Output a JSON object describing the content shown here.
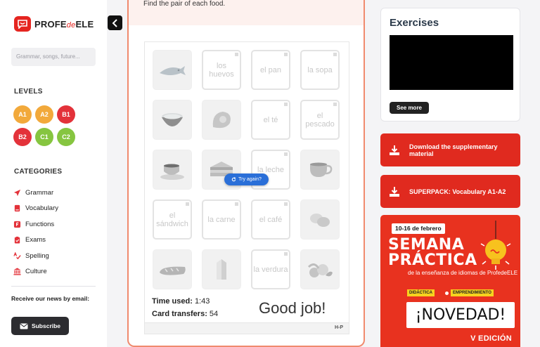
{
  "sidebar": {
    "logo": {
      "main": "PROFE",
      "de": "de",
      "end": "ELE"
    },
    "search_placeholder": "Grammar, songs, future...",
    "levels_title": "LEVELS",
    "levels": [
      {
        "label": "A1",
        "color": "#f2a93b"
      },
      {
        "label": "A2",
        "color": "#f2a93b"
      },
      {
        "label": "B1",
        "color": "#e3323a"
      },
      {
        "label": "B2",
        "color": "#e3323a"
      },
      {
        "label": "C1",
        "color": "#86c540"
      },
      {
        "label": "C2",
        "color": "#86c540"
      }
    ],
    "categories_title": "CATEGORIES",
    "categories": [
      {
        "label": "Grammar",
        "icon": "paper-plane-icon"
      },
      {
        "label": "Vocabulary",
        "icon": "book-icon"
      },
      {
        "label": "Functions",
        "icon": "f-square-icon"
      },
      {
        "label": "Exams",
        "icon": "clipboard-icon"
      },
      {
        "label": "Spelling",
        "icon": "spell-check-icon"
      },
      {
        "label": "Culture",
        "icon": "landmark-icon"
      }
    ],
    "news_text": "Receive our news by email:",
    "subscribe_label": "Subscribe"
  },
  "exercise": {
    "instruction": "Find the pair of each food.",
    "cards": [
      {
        "kind": "img",
        "icon": "fish-icon"
      },
      {
        "kind": "txt",
        "text": "los huevos"
      },
      {
        "kind": "txt",
        "text": "el pan"
      },
      {
        "kind": "txt",
        "text": "la sopa"
      },
      {
        "kind": "img",
        "icon": "soup-bowl-icon"
      },
      {
        "kind": "img",
        "icon": "ham-icon"
      },
      {
        "kind": "txt",
        "text": "el té"
      },
      {
        "kind": "txt",
        "text": "el pescado"
      },
      {
        "kind": "img",
        "icon": "coffee-cup-icon"
      },
      {
        "kind": "img",
        "icon": "sandwich-icon"
      },
      {
        "kind": "txt",
        "text": "la leche"
      },
      {
        "kind": "img",
        "icon": "tea-cup-icon"
      },
      {
        "kind": "txt",
        "text": "el sándwich"
      },
      {
        "kind": "txt",
        "text": "la carne"
      },
      {
        "kind": "txt",
        "text": "el café"
      },
      {
        "kind": "img",
        "icon": "eggs-icon"
      },
      {
        "kind": "img",
        "icon": "bread-icon"
      },
      {
        "kind": "img",
        "icon": "milk-carton-icon"
      },
      {
        "kind": "txt",
        "text": "la verdura"
      },
      {
        "kind": "img",
        "icon": "vegetables-icon"
      }
    ],
    "try_again_label": "Try again?",
    "time_label": "Time used:",
    "time_value": "1:43",
    "transfers_label": "Card transfers:",
    "transfers_value": "54",
    "result_text": "Good job!",
    "h5p_label": "H-P"
  },
  "right": {
    "exercises_title": "Exercises",
    "see_more_label": "See more",
    "download_label": "Download the supplementary material",
    "superpack_label": "SUPERPACK: Vocabulary A1-A2",
    "promo": {
      "date": "10-16 de febrero",
      "line1": "SEMANA",
      "line2": "PRÁCTICA",
      "subtitle": "de la enseñanza de idiomas de ProfedeELE",
      "tag1": "DIDÁCTICA",
      "tag2": "EMPRENDIMIENTO",
      "novedad": "¡NOVEDAD!",
      "edition": "V EDICIÓN"
    }
  }
}
